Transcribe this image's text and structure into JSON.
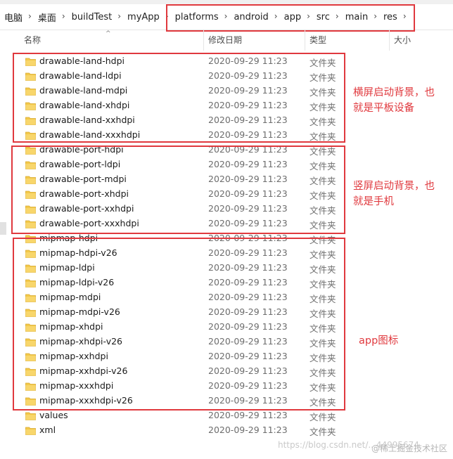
{
  "colors": {
    "annotation_red": "#e0393e",
    "folder_yellow": "#f3c94a"
  },
  "breadcrumb": [
    {
      "label": "电脑"
    },
    {
      "label": "桌面"
    },
    {
      "label": "buildTest"
    },
    {
      "label": "myApp"
    },
    {
      "label": "platforms"
    },
    {
      "label": "android"
    },
    {
      "label": "app"
    },
    {
      "label": "src"
    },
    {
      "label": "main"
    },
    {
      "label": "res"
    }
  ],
  "header": {
    "name": "名称",
    "modified": "修改日期",
    "type": "类型",
    "size": "大小",
    "sort_icon": "caret-up-icon"
  },
  "files": [
    {
      "name": "drawable-land-hdpi",
      "modified": "2020-09-29 11:23",
      "type": "文件夹"
    },
    {
      "name": "drawable-land-ldpi",
      "modified": "2020-09-29 11:23",
      "type": "文件夹"
    },
    {
      "name": "drawable-land-mdpi",
      "modified": "2020-09-29 11:23",
      "type": "文件夹"
    },
    {
      "name": "drawable-land-xhdpi",
      "modified": "2020-09-29 11:23",
      "type": "文件夹"
    },
    {
      "name": "drawable-land-xxhdpi",
      "modified": "2020-09-29 11:23",
      "type": "文件夹"
    },
    {
      "name": "drawable-land-xxxhdpi",
      "modified": "2020-09-29 11:23",
      "type": "文件夹"
    },
    {
      "name": "drawable-port-hdpi",
      "modified": "2020-09-29 11:23",
      "type": "文件夹"
    },
    {
      "name": "drawable-port-ldpi",
      "modified": "2020-09-29 11:23",
      "type": "文件夹"
    },
    {
      "name": "drawable-port-mdpi",
      "modified": "2020-09-29 11:23",
      "type": "文件夹"
    },
    {
      "name": "drawable-port-xhdpi",
      "modified": "2020-09-29 11:23",
      "type": "文件夹"
    },
    {
      "name": "drawable-port-xxhdpi",
      "modified": "2020-09-29 11:23",
      "type": "文件夹"
    },
    {
      "name": "drawable-port-xxxhdpi",
      "modified": "2020-09-29 11:23",
      "type": "文件夹"
    },
    {
      "name": "mipmap-hdpi",
      "modified": "2020-09-29 11:23",
      "type": "文件夹"
    },
    {
      "name": "mipmap-hdpi-v26",
      "modified": "2020-09-29 11:23",
      "type": "文件夹"
    },
    {
      "name": "mipmap-ldpi",
      "modified": "2020-09-29 11:23",
      "type": "文件夹"
    },
    {
      "name": "mipmap-ldpi-v26",
      "modified": "2020-09-29 11:23",
      "type": "文件夹"
    },
    {
      "name": "mipmap-mdpi",
      "modified": "2020-09-29 11:23",
      "type": "文件夹"
    },
    {
      "name": "mipmap-mdpi-v26",
      "modified": "2020-09-29 11:23",
      "type": "文件夹"
    },
    {
      "name": "mipmap-xhdpi",
      "modified": "2020-09-29 11:23",
      "type": "文件夹"
    },
    {
      "name": "mipmap-xhdpi-v26",
      "modified": "2020-09-29 11:23",
      "type": "文件夹"
    },
    {
      "name": "mipmap-xxhdpi",
      "modified": "2020-09-29 11:23",
      "type": "文件夹"
    },
    {
      "name": "mipmap-xxhdpi-v26",
      "modified": "2020-09-29 11:23",
      "type": "文件夹"
    },
    {
      "name": "mipmap-xxxhdpi",
      "modified": "2020-09-29 11:23",
      "type": "文件夹"
    },
    {
      "name": "mipmap-xxxhdpi-v26",
      "modified": "2020-09-29 11:23",
      "type": "文件夹"
    },
    {
      "name": "values",
      "modified": "2020-09-29 11:23",
      "type": "文件夹"
    },
    {
      "name": "xml",
      "modified": "2020-09-29 11:23",
      "type": "文件夹"
    }
  ],
  "annotations": {
    "land_line1": "横屏启动背景，也",
    "land_line2": "就是平板设备",
    "port_line1": "竖屏启动背景，也",
    "port_line2": "就是手机",
    "mipmap": "app图标"
  },
  "watermark": {
    "blog": "https://blog.csdn.net/...44995674",
    "brand": "@稀土掘金技术社区"
  }
}
